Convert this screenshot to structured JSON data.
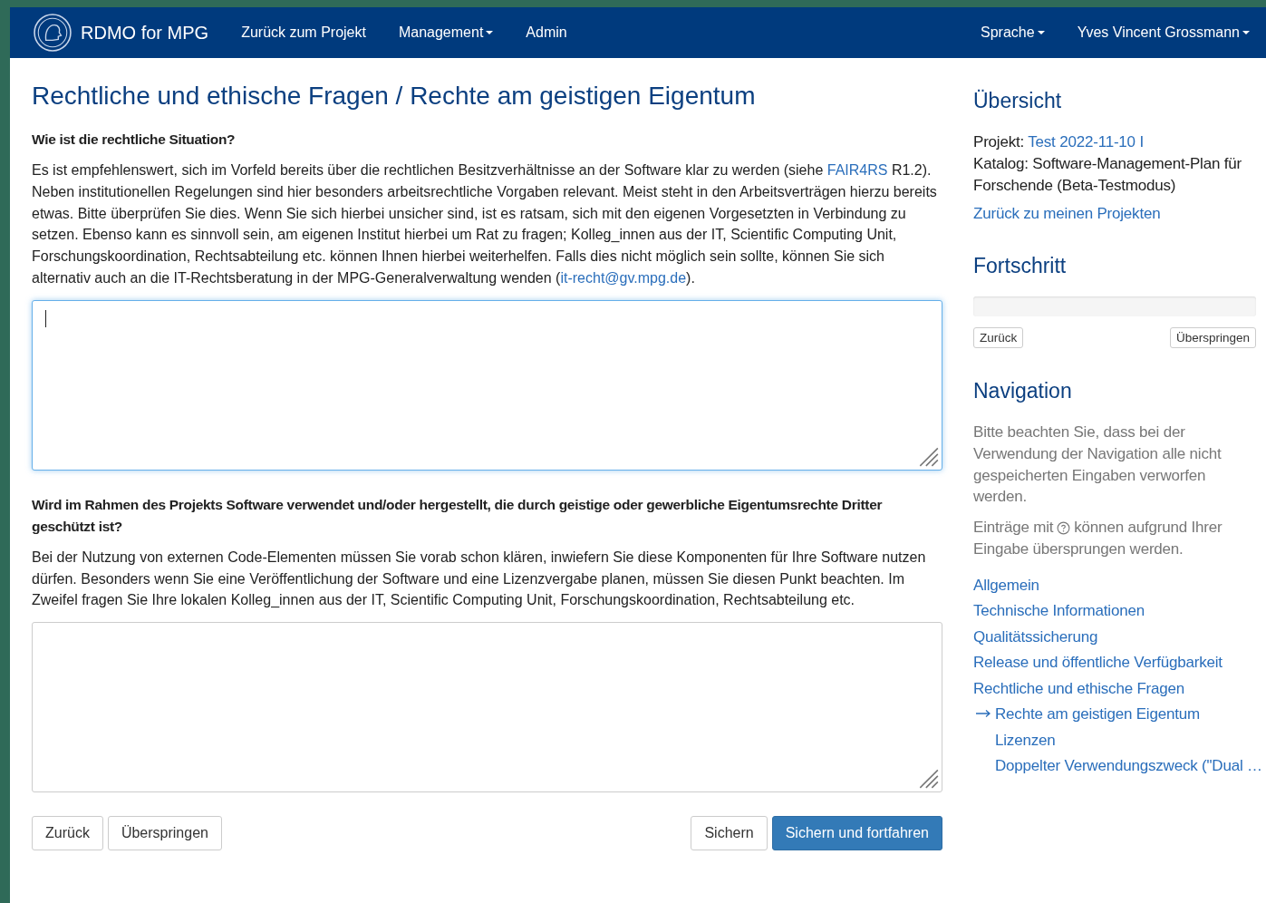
{
  "navbar": {
    "brand": "RDMO for MPG",
    "items": [
      {
        "label": "Zurück zum Projekt",
        "dropdown": false
      },
      {
        "label": "Management",
        "dropdown": true
      },
      {
        "label": "Admin",
        "dropdown": false
      }
    ],
    "right_items": [
      {
        "label": "Sprache",
        "dropdown": true
      },
      {
        "label": "Yves Vincent Grossmann",
        "dropdown": true
      }
    ]
  },
  "main": {
    "title": "Rechtliche und ethische Fragen / Rechte am geistigen Eigentum",
    "questions": [
      {
        "label": "Wie ist die rechtliche Situation?",
        "help": [
          {
            "kind": "text",
            "text": "Es ist empfehlenswert, sich im Vorfeld bereits über die rechtlichen Besitzverhältnisse an der Software klar zu werden (siehe "
          },
          {
            "kind": "link",
            "text": "FAIR4RS"
          },
          {
            "kind": "text",
            "text": " R1.2). Neben institutionellen Regelungen sind hier besonders arbeitsrechtliche Vorgaben relevant. Meist steht in den Arbeitsverträgen hierzu bereits etwas. Bitte überprüfen Sie dies. Wenn Sie sich hierbei unsicher sind, ist es ratsam, sich mit den eigenen Vorgesetzten in Verbindung zu setzen. Ebenso kann es sinnvoll sein, am eigenen Institut hierbei um Rat zu fragen; Kolleg_innen aus der IT, Scientific Computing Unit, Forschungskoordination, Rechtsabteilung etc. können Ihnen hierbei weiterhelfen. Falls dies nicht möglich sein sollte, können Sie sich alternativ auch an die IT-Rechtsberatung in der MPG-Generalverwaltung wenden ("
          },
          {
            "kind": "link",
            "text": "it-recht@gv.mpg.de"
          },
          {
            "kind": "text",
            "text": ")."
          }
        ],
        "focused": true
      },
      {
        "label": "Wird im Rahmen des Projekts Software verwendet und/oder hergestellt, die durch geistige oder gewerbliche Eigentumsrechte Dritter geschützt ist?",
        "help": [
          {
            "kind": "text",
            "text": "Bei der Nutzung von externen Code-Elementen müssen Sie vorab schon klären, inwiefern Sie diese Komponenten für Ihre Software nutzen dürfen. Besonders wenn Sie eine Veröffentlichung der Software und eine Lizenzvergabe planen, müssen Sie diesen Punkt beachten. Im Zweifel fragen Sie Ihre lokalen Kolleg_innen aus der IT, Scientific Computing Unit, Forschungskoordination, Rechtsabteilung etc."
          }
        ],
        "focused": false
      }
    ],
    "buttons_left": [
      "Zurück",
      "Überspringen"
    ],
    "buttons_right": [
      {
        "label": "Sichern",
        "primary": false
      },
      {
        "label": "Sichern und fortfahren",
        "primary": true
      }
    ]
  },
  "sidebar": {
    "overview": {
      "title": "Übersicht",
      "project_label": "Projekt:",
      "project_link": "Test 2022-11-10 I",
      "catalog": "Katalog: Software-Management-Plan für Forschende (Beta-Testmodus)",
      "back_link": "Zurück zu meinen Projekten"
    },
    "progress": {
      "title": "Fortschritt",
      "level": 0,
      "back": "Zurück",
      "skip": "Überspringen"
    },
    "navigation": {
      "title": "Navigation",
      "note": "Bitte beachten Sie, dass bei der Verwendung der Navigation alle nicht gespeicherten Eingaben verworfen werden.",
      "hint_before": "Einträge mit",
      "hint_after": "können aufgrund Ihrer",
      "hint_end": "Eingabe übersprungen werden.",
      "items": [
        {
          "label": "Allgemein",
          "selected": false
        },
        {
          "label": "Technische Informationen",
          "selected": false
        },
        {
          "label": "Qualitätssicherung",
          "selected": false
        },
        {
          "label": "Release und öffentliche Verfügbarkeit",
          "selected": false
        },
        {
          "label": "Rechtliche und ethische Fragen",
          "selected": false,
          "children": [
            {
              "label": "Rechte am geistigen Eigentum",
              "selected": true
            },
            {
              "label": "Lizenzen",
              "selected": false
            },
            {
              "label": "Doppelter Verwendungszweck (\"Dual …",
              "selected": false
            }
          ]
        }
      ]
    }
  }
}
